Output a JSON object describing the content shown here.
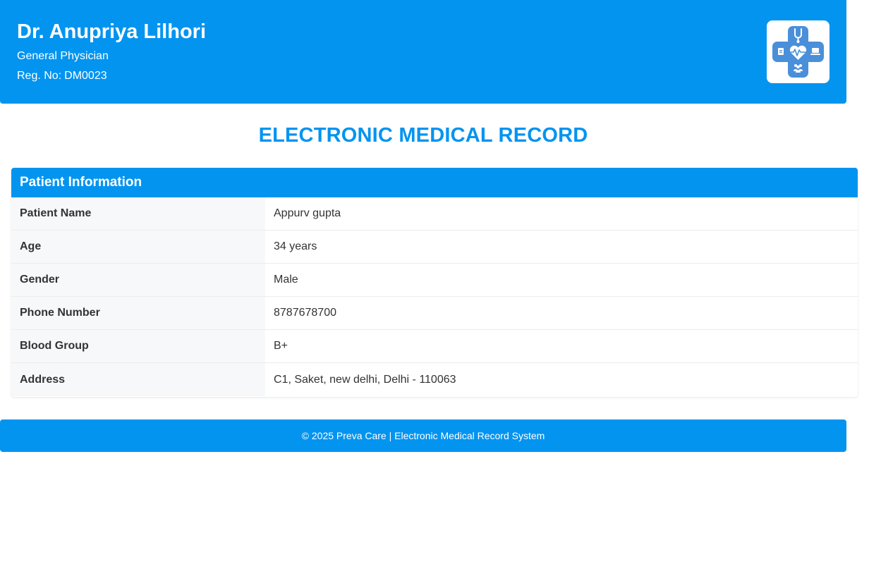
{
  "doctor": {
    "name": "Dr. Anupriya Lilhori",
    "specialty": "General Physician",
    "reg_label": "Reg. No:",
    "reg_no": "DM0023",
    "logo_icon": "medical-cross-logo-icon"
  },
  "page_title": "ELECTRONIC MEDICAL RECORD",
  "patient_info": {
    "heading": "Patient Information",
    "rows": [
      {
        "label": "Patient Name",
        "value": "Appurv gupta"
      },
      {
        "label": "Age",
        "value": "34 years"
      },
      {
        "label": "Gender",
        "value": "Male"
      },
      {
        "label": "Phone Number",
        "value": "8787678700"
      },
      {
        "label": "Blood Group",
        "value": "B+"
      },
      {
        "label": "Address",
        "value": "C1, Saket, new delhi, Delhi - 110063"
      }
    ]
  },
  "footer": {
    "text": "© 2025 Preva Care | Electronic Medical Record System"
  },
  "colors": {
    "primary": "#0394f0",
    "label_bg": "#f7f8fa",
    "logo_blue": "#4a8fd9"
  }
}
